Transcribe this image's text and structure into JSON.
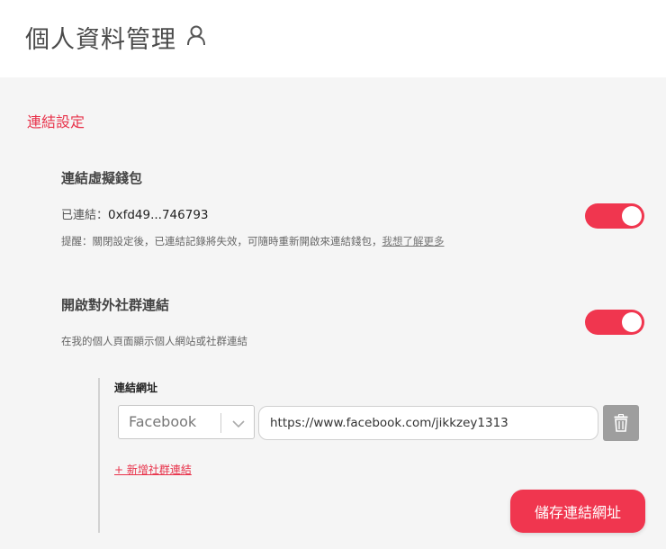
{
  "header": {
    "title": "個人資料管理",
    "icon": "user-icon"
  },
  "section": {
    "title": "連結設定"
  },
  "wallet": {
    "title": "連結虛擬錢包",
    "status_label": "已連結：",
    "address": "0xfd49...746793",
    "hint": "提醒：關閉設定後，已連結記錄將失效，可隨時重新開啟來連結錢包，",
    "learn_more": "我想了解更多",
    "enabled": true
  },
  "social": {
    "title": "開啟對外社群連結",
    "description": "在我的個人頁面顯示個人網站或社群連結",
    "enabled": true,
    "field_label": "連結網址",
    "platform": "Facebook",
    "url": "https://www.facebook.com/jikkzey1313",
    "add_label": "+ 新增社群連結",
    "save_label": "儲存連結網址"
  },
  "colors": {
    "accent": "#f0364f",
    "delete_button": "#9e9e9e"
  }
}
